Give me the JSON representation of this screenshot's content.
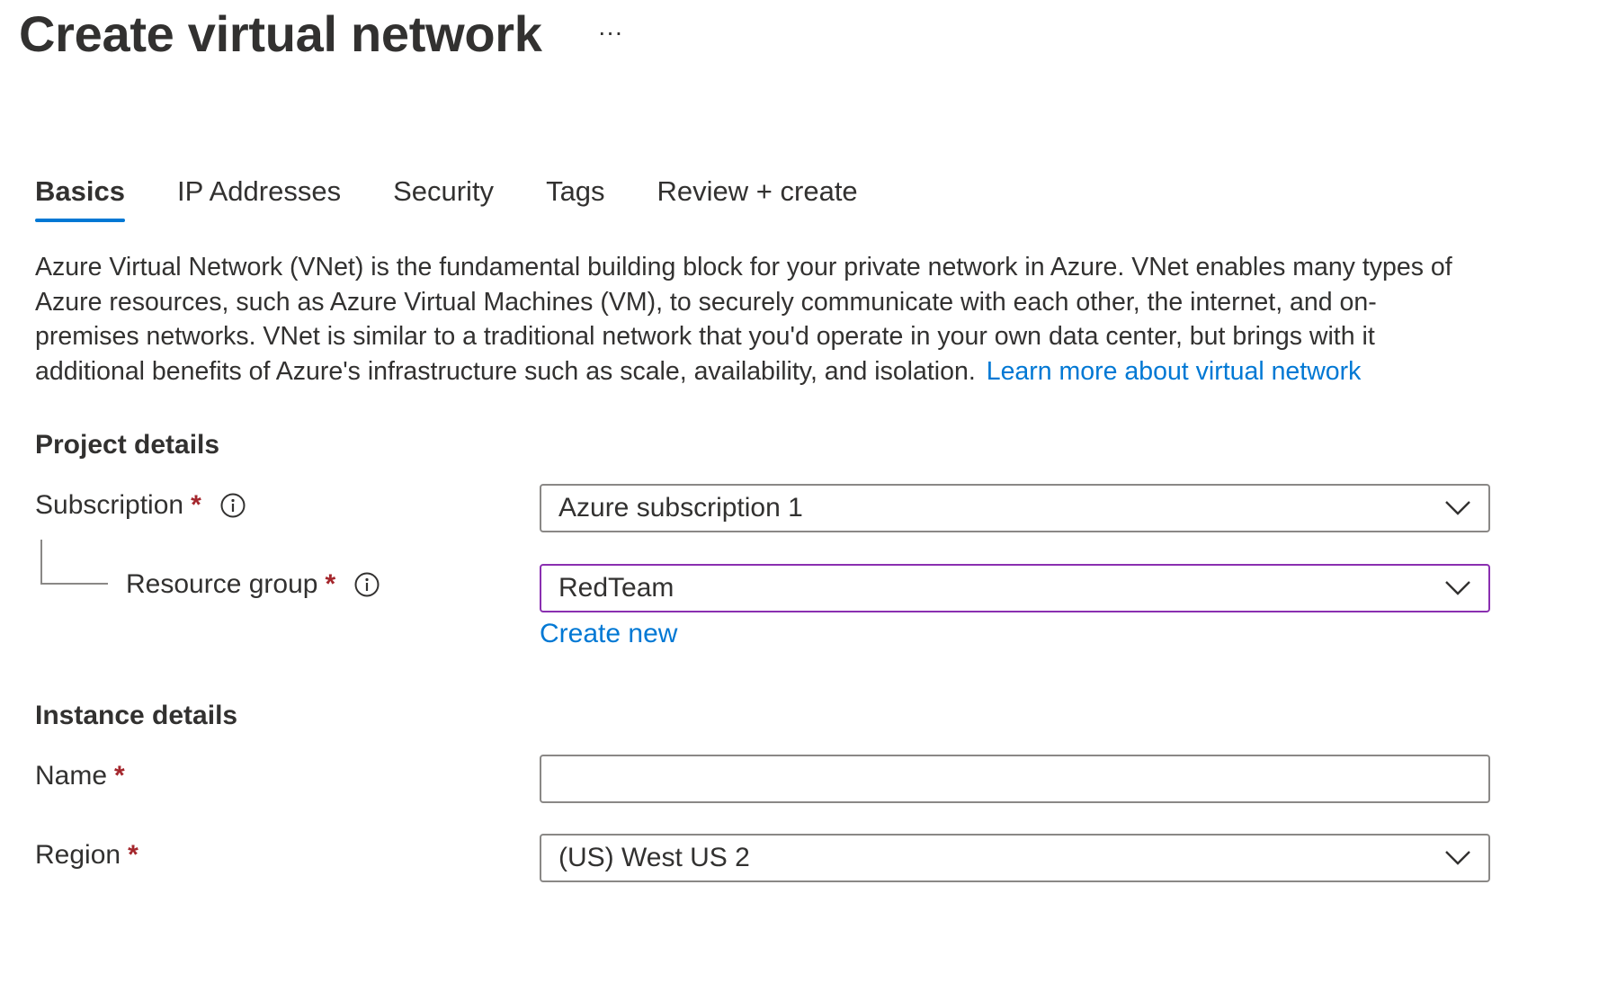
{
  "header": {
    "title": "Create virtual network",
    "more_label": "···"
  },
  "tabs": [
    {
      "label": "Basics",
      "active": true
    },
    {
      "label": "IP Addresses",
      "active": false
    },
    {
      "label": "Security",
      "active": false
    },
    {
      "label": "Tags",
      "active": false
    },
    {
      "label": "Review + create",
      "active": false
    }
  ],
  "description": {
    "text": "Azure Virtual Network (VNet) is the fundamental building block for your private network in Azure. VNet enables many types of Azure resources, such as Azure Virtual Machines (VM), to securely communicate with each other, the internet, and on-premises networks. VNet is similar to a traditional network that you'd operate in your own data center, but brings with it additional benefits of Azure's infrastructure such as scale, availability, and isolation.",
    "link_label": "Learn more about virtual network"
  },
  "project_details": {
    "title": "Project details",
    "subscription": {
      "label": "Subscription",
      "required_mark": "*",
      "value": "Azure subscription 1"
    },
    "resource_group": {
      "label": "Resource group",
      "required_mark": "*",
      "value": "RedTeam",
      "create_new_label": "Create new"
    }
  },
  "instance_details": {
    "title": "Instance details",
    "name": {
      "label": "Name",
      "required_mark": "*",
      "value": ""
    },
    "region": {
      "label": "Region",
      "required_mark": "*",
      "value": "(US) West US 2"
    }
  },
  "colors": {
    "accent": "#0078d4",
    "required": "#a4262c",
    "focus_border": "#8a2fb0",
    "border": "#8a8886",
    "text": "#323130"
  },
  "icons": {
    "info": "info-icon",
    "chevron": "chevron-down-icon",
    "more": "more-options-icon"
  }
}
